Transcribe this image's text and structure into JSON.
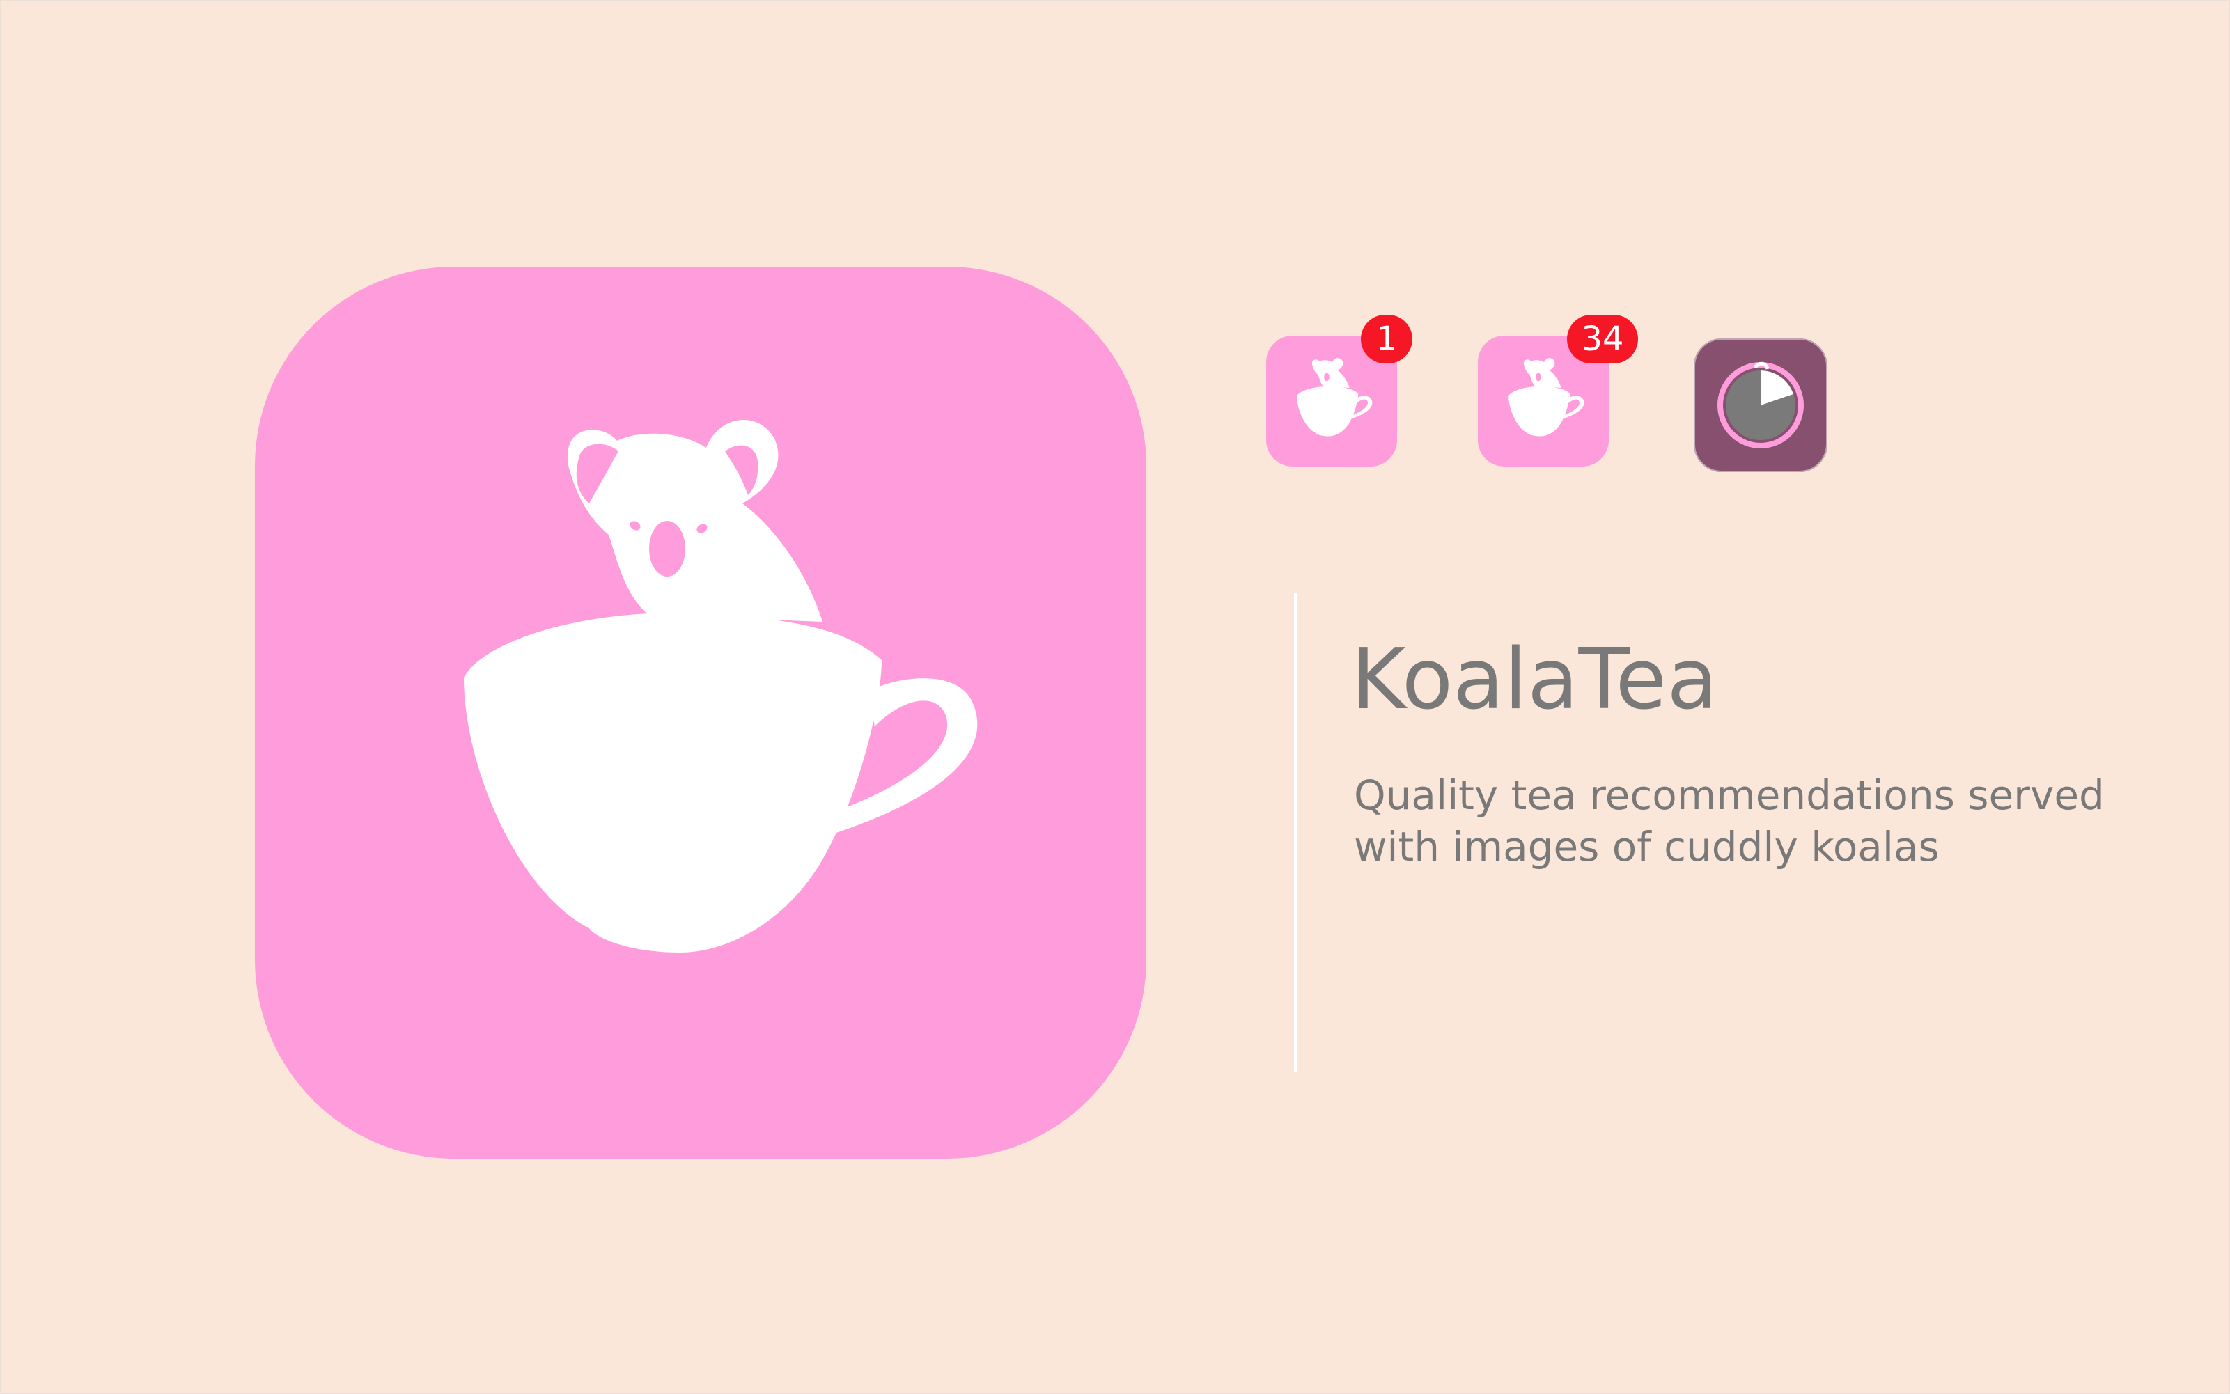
{
  "app": {
    "name": "KoalaTea",
    "tagline_lines": [
      "Quality tea recommendations served",
      "with images of cuddly koalas"
    ]
  },
  "icons": {
    "main": {
      "glyph": "koala-teacup-icon"
    },
    "variants": [
      {
        "glyph": "koala-teacup-icon",
        "badge": "1"
      },
      {
        "glyph": "koala-teacup-icon",
        "badge": "34"
      },
      {
        "glyph": "timer-icon",
        "badge": ""
      }
    ]
  },
  "colors": {
    "background": "#fae7da",
    "icon_pink": "#ff9cdc",
    "timer_purple": "#87506e",
    "badge_red": "#f51726",
    "text_gray": "#797979"
  }
}
